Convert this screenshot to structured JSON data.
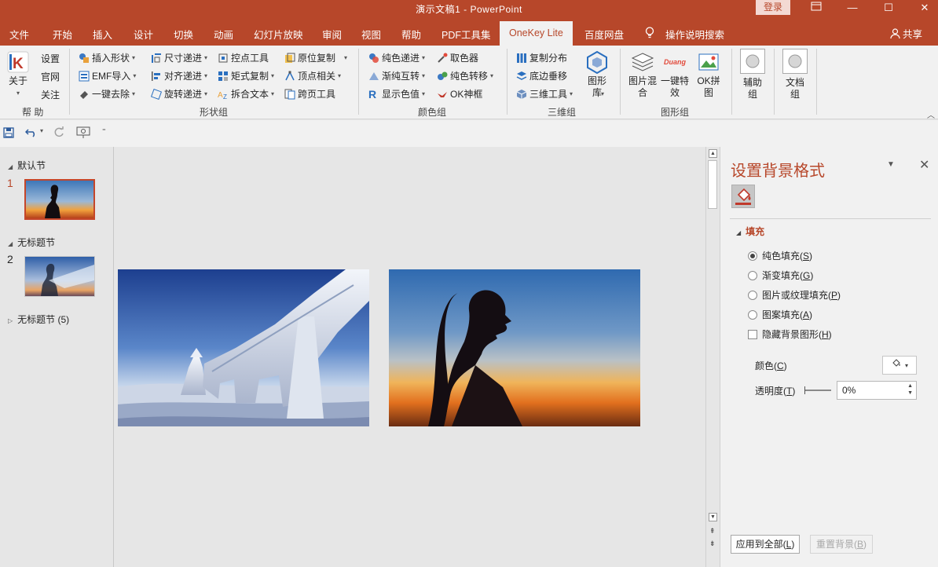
{
  "titlebar": {
    "title": "演示文稿1  -  PowerPoint",
    "login": "登录",
    "restore_icon": "ribbon-display-icon",
    "minimize": "—",
    "maximize": "☐",
    "close": "✕"
  },
  "tabs": [
    "文件",
    "开始",
    "插入",
    "设计",
    "切换",
    "动画",
    "幻灯片放映",
    "审阅",
    "视图",
    "帮助",
    "PDF工具集",
    "OneKey Lite",
    "百度网盘",
    "操作说明搜索"
  ],
  "active_tab": "OneKey Lite",
  "share": "共享",
  "ribbon": {
    "help_group": {
      "about": "关于",
      "settings": "设置",
      "website": "官网",
      "follow": "关注",
      "label": "帮 助"
    },
    "shape_group": {
      "label": "形状组",
      "items": [
        "插入形状",
        "尺寸递进",
        "控点工具",
        "原位复制",
        "EMF导入",
        "对齐递进",
        "矩式复制",
        "顶点相关",
        "一键去除",
        "旋转递进",
        "拆合文本",
        "跨页工具"
      ]
    },
    "color_group": {
      "label": "颜色组",
      "items": [
        "纯色递进",
        "取色器",
        "渐纯互转",
        "纯色转移",
        "显示色值",
        "OK神框"
      ]
    },
    "threed_group": {
      "label": "三维组",
      "items": [
        "复制分布",
        "底边垂移",
        "三维工具"
      ],
      "big": "图形\n库"
    },
    "graphic_group": {
      "label": "图形组",
      "big": [
        "图片混\n合",
        "一键特\n效",
        "OK拼\n图"
      ],
      "duang": "Duang"
    },
    "aux_group": {
      "label": "辅助\n组"
    },
    "doc_group": {
      "label": "文档\n组"
    }
  },
  "sections": [
    {
      "name": "默认节",
      "slides": [
        1
      ]
    },
    {
      "name": "无标题节",
      "slides": [
        2
      ]
    },
    {
      "name": "无标题节 (5)",
      "slides": []
    }
  ],
  "slide_numbers": [
    "1",
    "2"
  ],
  "format_pane": {
    "title": "设置背景格式",
    "section": "填充",
    "fill_options": [
      {
        "label": "纯色填充(",
        "key": "S",
        "selected": true
      },
      {
        "label": "渐变填充(",
        "key": "G",
        "selected": false
      },
      {
        "label": "图片或纹理填充(",
        "key": "P",
        "selected": false
      },
      {
        "label": "图案填充(",
        "key": "A",
        "selected": false
      }
    ],
    "hide_bg_label": "隐藏背景图形(",
    "hide_bg_key": "H",
    "color_label": "颜色(",
    "color_key": "C",
    "transparency_label": "透明度(",
    "transparency_key": "T",
    "transparency_value": "0%",
    "apply_all": "应用到全部(",
    "apply_all_key": "L",
    "reset": "重置背景(",
    "reset_key": "B"
  },
  "colors": {
    "accent": "#b7472a",
    "ribbon_bg": "#f1f1f1",
    "canvas_bg": "#e6e6e6"
  }
}
